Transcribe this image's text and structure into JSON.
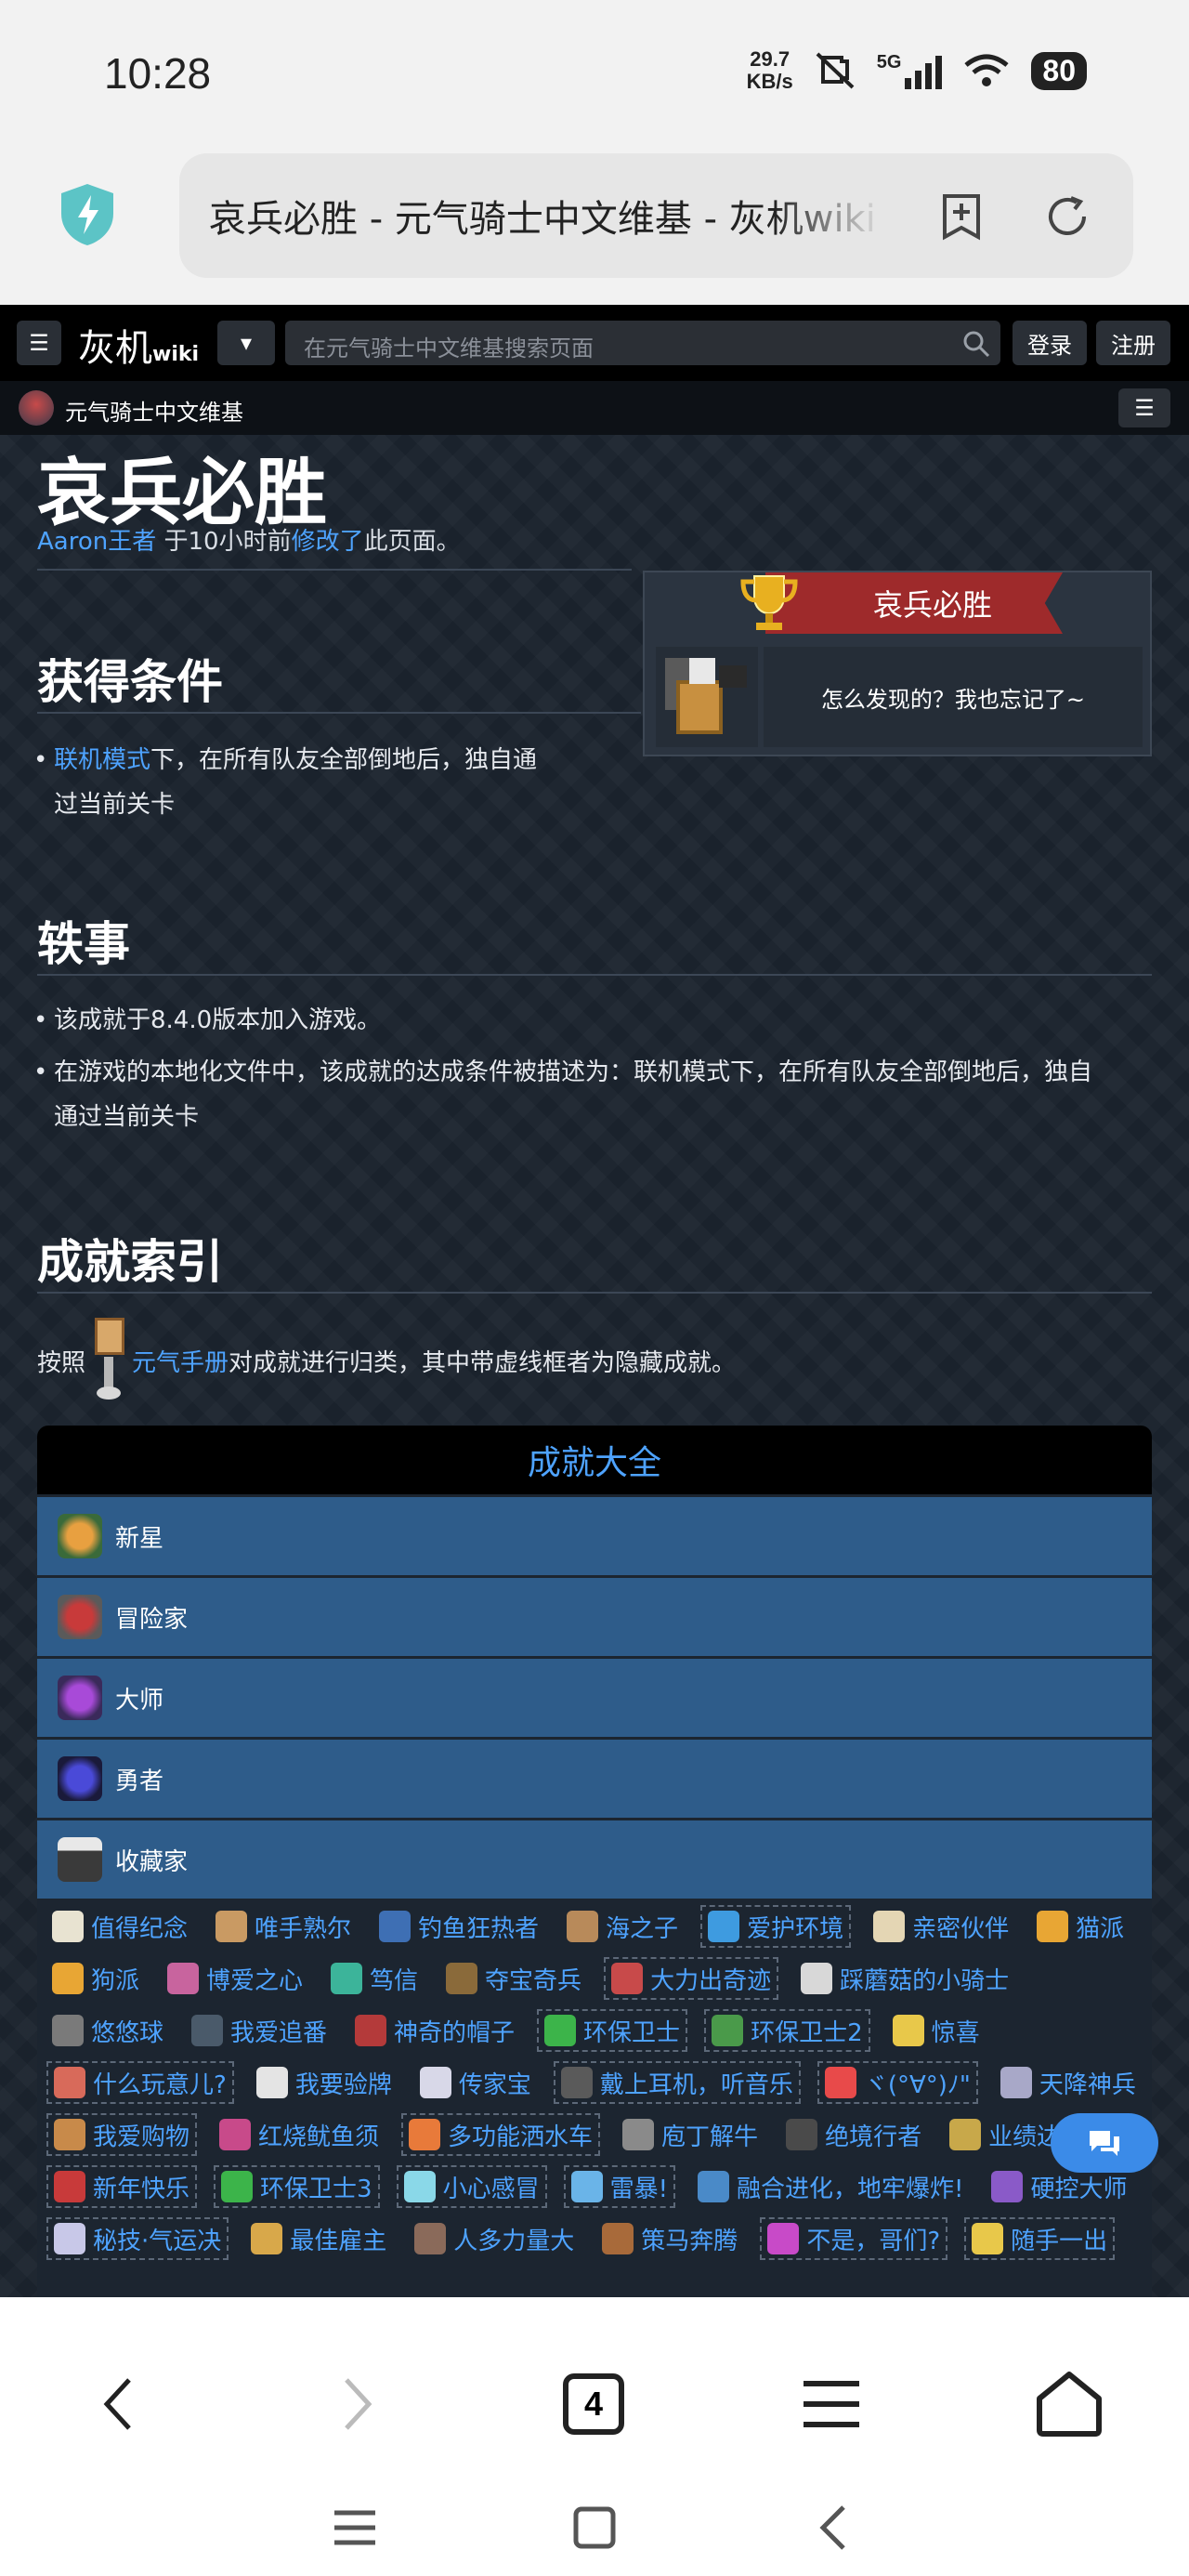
{
  "status": {
    "time": "10:28",
    "net_speed_value": "29.7",
    "net_speed_unit": "KB/s",
    "network": "5G",
    "battery": "80"
  },
  "browser": {
    "url_text": "哀兵必胜 - 元气骑士中文维基 - 灰机wiki",
    "tabs_count": "4"
  },
  "site": {
    "logo_main": "灰机",
    "logo_sub": "wiki",
    "search_placeholder": "在元气骑士中文维基搜索页面",
    "login": "登录",
    "register": "注册",
    "wiki_name": "元气骑士中文维基"
  },
  "page": {
    "title": "哀兵必胜",
    "meta_user": "Aaron王者",
    "meta_time": " 于10小时前",
    "meta_edit": "修改了",
    "meta_tail": "此页面。",
    "section1_title": "获得条件",
    "s1_link": "联机模式",
    "s1_text_line1": "下，在所有队友全部倒地后，独自通",
    "s1_text_line2": "过当前关卡",
    "section2_title": "轶事",
    "s2_item1": "该成就于8.4.0版本加入游戏。",
    "s2_item2_line1": "在游戏的本地化文件中，该成就的达成条件被描述为：联机模式下，在所有队友全部倒地后，独自",
    "s2_item2_line2": "通过当前关卡",
    "section3_title": "成就索引",
    "s3_pre": "按照",
    "s3_link": "元气手册",
    "s3_post": "对成就进行归类，其中带虚线框者为隐藏成就。"
  },
  "infobox": {
    "title": "哀兵必胜",
    "description": "怎么发现的？我也忘记了~"
  },
  "achievements": {
    "header": "成就大全",
    "categories": [
      "新星",
      "冒险家",
      "大师",
      "勇者",
      "收藏家"
    ],
    "chips": [
      {
        "label": "值得纪念",
        "hidden": false,
        "color": "#e8e3d1"
      },
      {
        "label": "唯手熟尔",
        "hidden": false,
        "color": "#c99a63"
      },
      {
        "label": "钓鱼狂热者",
        "hidden": false,
        "color": "#3e6fb4"
      },
      {
        "label": "海之子",
        "hidden": false,
        "color": "#b88a5a"
      },
      {
        "label": "爱护环境",
        "hidden": true,
        "color": "#3e9be0"
      },
      {
        "label": "亲密伙伴",
        "hidden": false,
        "color": "#e4d6b4"
      },
      {
        "label": "猫派",
        "hidden": false,
        "color": "#e8a634"
      },
      {
        "label": "狗派",
        "hidden": false,
        "color": "#e8a634"
      },
      {
        "label": "博爱之心",
        "hidden": false,
        "color": "#c8649e"
      },
      {
        "label": "笃信",
        "hidden": false,
        "color": "#3cb49a"
      },
      {
        "label": "夺宝奇兵",
        "hidden": false,
        "color": "#8a6a3a"
      },
      {
        "label": "大力出奇迹",
        "hidden": true,
        "color": "#c84a4a"
      },
      {
        "label": "踩蘑菇的小骑士",
        "hidden": false,
        "color": "#d8d8d8"
      },
      {
        "label": "悠悠球",
        "hidden": false,
        "color": "#7a7a7a"
      },
      {
        "label": "我爱追番",
        "hidden": false,
        "color": "#4a5a6a"
      },
      {
        "label": "神奇的帽子",
        "hidden": false,
        "color": "#b43a3a"
      },
      {
        "label": "环保卫士",
        "hidden": true,
        "color": "#3cb44a"
      },
      {
        "label": "环保卫士2",
        "hidden": true,
        "color": "#4a9a4a"
      },
      {
        "label": "惊喜",
        "hidden": false,
        "color": "#e8c84a"
      },
      {
        "label": "什么玩意儿?",
        "hidden": true,
        "color": "#d86a5a"
      },
      {
        "label": "我要验牌",
        "hidden": false,
        "color": "#e4e4e4"
      },
      {
        "label": "传家宝",
        "hidden": false,
        "color": "#d8d8e8"
      },
      {
        "label": "戴上耳机，听音乐",
        "hidden": true,
        "color": "#5a5a5a"
      },
      {
        "label": "ヾ(°∀°)ﾉ\"",
        "hidden": true,
        "color": "#e84a4a"
      },
      {
        "label": "天降神兵",
        "hidden": false,
        "color": "#a8a8c8"
      },
      {
        "label": "我爱购物",
        "hidden": true,
        "color": "#c88a4a"
      },
      {
        "label": "红烧鱿鱼须",
        "hidden": false,
        "color": "#c84a8a"
      },
      {
        "label": "多功能洒水车",
        "hidden": true,
        "color": "#e87a3a"
      },
      {
        "label": "庖丁解牛",
        "hidden": false,
        "color": "#8a8a8a"
      },
      {
        "label": "绝境行者",
        "hidden": false,
        "color": "#4a4a4a"
      },
      {
        "label": "业绩达成!",
        "hidden": false,
        "color": "#c8a84a"
      },
      {
        "label": "新年快乐",
        "hidden": true,
        "color": "#c83a3a"
      },
      {
        "label": "环保卫士3",
        "hidden": true,
        "color": "#3cb44a"
      },
      {
        "label": "小心感冒",
        "hidden": true,
        "color": "#8ad8e8"
      },
      {
        "label": "雷暴!",
        "hidden": true,
        "color": "#6ab4e8"
      },
      {
        "label": "融合进化，地牢爆炸!",
        "hidden": false,
        "color": "#4a8ac8"
      },
      {
        "label": "硬控大师",
        "hidden": false,
        "color": "#8a5ac8"
      },
      {
        "label": "秘技·气运决",
        "hidden": true,
        "color": "#c8c8e8"
      },
      {
        "label": "最佳雇主",
        "hidden": false,
        "color": "#d8a84a"
      },
      {
        "label": "人多力量大",
        "hidden": false,
        "color": "#8a6a5a"
      },
      {
        "label": "策马奔腾",
        "hidden": false,
        "color": "#a86a3a"
      },
      {
        "label": "不是，哥们?",
        "hidden": true,
        "color": "#c84ac8"
      },
      {
        "label": "随手一出",
        "hidden": true,
        "color": "#e8c84a"
      }
    ]
  }
}
